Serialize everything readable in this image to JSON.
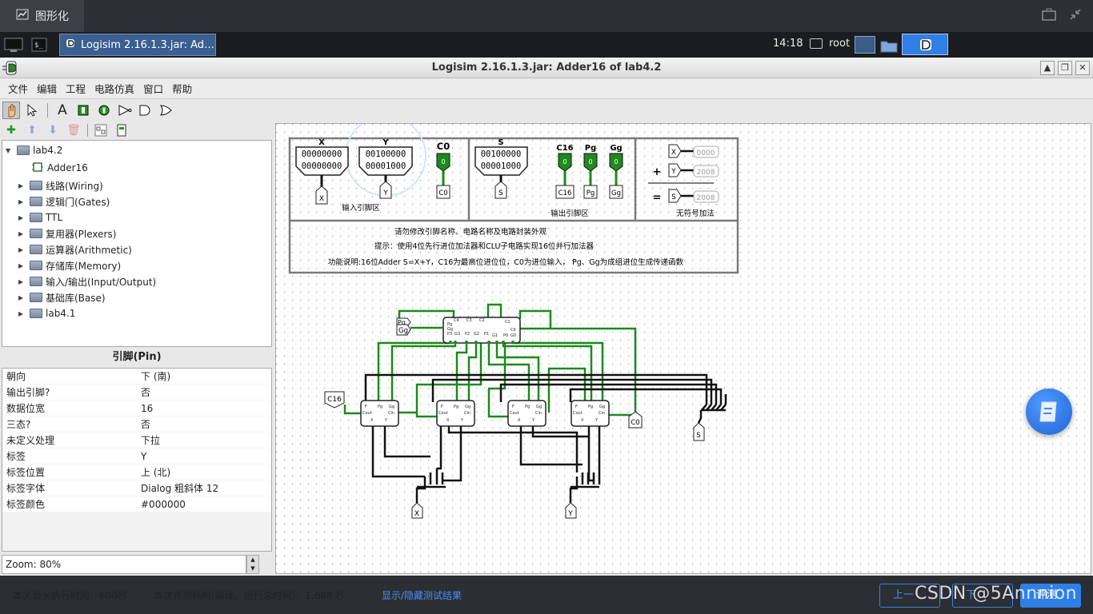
{
  "app_tab": {
    "label": "图形化"
  },
  "taskbar": {
    "window_label": "Logisim 2.16.1.3.jar: Ad…",
    "clock": "14:18",
    "user": "root"
  },
  "window": {
    "title": "Logisim 2.16.1.3.jar: Adder16 of lab4.2"
  },
  "menu": [
    "文件",
    "编辑",
    "工程",
    "电路仿真",
    "窗口",
    "帮助"
  ],
  "toolbar": {
    "text_tool": "A"
  },
  "tree": {
    "root": "lab4.2",
    "circuit": "Adder16",
    "libraries": [
      "线路(Wiring)",
      "逻辑门(Gates)",
      "TTL",
      "复用器(Plexers)",
      "运算器(Arithmetic)",
      "存储库(Memory)",
      "输入/输出(Input/Output)",
      "基础库(Base)",
      "lab4.1"
    ]
  },
  "attributes": {
    "title": "引脚(Pin)",
    "rows": [
      {
        "key": "朝向",
        "value": "下 (南)"
      },
      {
        "key": "输出引脚?",
        "value": "否"
      },
      {
        "key": "数据位宽",
        "value": "16"
      },
      {
        "key": "三态?",
        "value": "否"
      },
      {
        "key": "未定义处理",
        "value": "下拉"
      },
      {
        "key": "标签",
        "value": "Y"
      },
      {
        "key": "标签位置",
        "value": "上 (北)"
      },
      {
        "key": "标签字体",
        "value": "Dialog 粗斜体 12"
      },
      {
        "key": "标签颜色",
        "value": "#000000"
      }
    ]
  },
  "zoom": "Zoom: 80%",
  "circuit": {
    "pin_x": {
      "label": "X",
      "bits_row1": "00000000",
      "bits_row2": "00000000"
    },
    "pin_y": {
      "label": "Y",
      "bits_row1": "00100000",
      "bits_row2": "00001000"
    },
    "pin_c0": {
      "label": "C0",
      "value": "0"
    },
    "input_area": "输入引脚区",
    "pin_s": {
      "label": "S",
      "bits_row1": "00100000",
      "bits_row2": "00001000"
    },
    "out_c16": {
      "label": "C16",
      "value": "0"
    },
    "out_pg": {
      "label": "Pg",
      "value": "0"
    },
    "out_gg": {
      "label": "Gg",
      "value": "0"
    },
    "output_area": "输出引脚区",
    "probe_x": "0000",
    "probe_y": "2008",
    "probe_s": "2008",
    "plus": "+",
    "equals": "=",
    "unsigned_add": "无符号加法",
    "note1": "请勿修改引脚名称、电路名称及电路封装外观",
    "note2": "提示：使用4位先行进位加法器和CLU子电路实现16位并行加法器",
    "note3": "功能说明:16位Adder  S=X+Y，C16为最高位进位位，C0为进位输入， Pg、Gg为成组进位生成传递函数",
    "tunnel_pg": "Pg",
    "tunnel_gg": "Gg",
    "tunnel_c16": "C16",
    "tunnel_c0": "C0",
    "tunnel_s": "S",
    "tunnel_x": "X",
    "tunnel_y": "Y"
  },
  "status": {
    "max_time": "本关最大执行时间：600秒",
    "elapsed": "本次评测耗时(编译、运行总时间)：1.688 秒",
    "toggle_results": "显示/隐藏测试结果",
    "prev": "上一",
    "next": "下",
    "submit": "评测"
  },
  "watermark": "CSDN @5Annnion",
  "colors": {
    "wire_on": "#1b8a1b",
    "wire_off": "#000000",
    "link": "#4d8ef0",
    "accent": "#2f7fe6"
  }
}
